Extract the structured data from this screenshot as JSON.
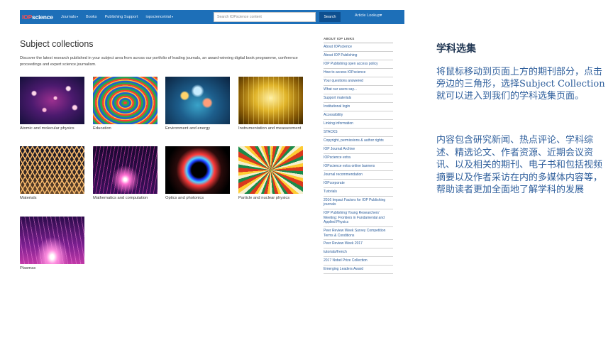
{
  "navbar": {
    "logo_prefix": "IOP",
    "logo_suffix": "science",
    "items": [
      {
        "label": "Journals",
        "has_caret": true
      },
      {
        "label": "Books",
        "has_caret": false
      },
      {
        "label": "Publishing Support",
        "has_caret": false
      },
      {
        "label": "iopsciencetrial",
        "has_caret": true
      }
    ],
    "search_placeholder": "Search IOPscience content",
    "search_button": "Search",
    "article_lookup": "Article Lookup",
    "caret_glyph": "▾"
  },
  "main": {
    "title": "Subject collections",
    "intro": "Discover the latest research published in your subject area from across our portfolio of leading journals, an award-winning digital book programme, conference proceedings and expert science journalism.",
    "collections": [
      {
        "label": "Atomic and molecular physics"
      },
      {
        "label": "Education"
      },
      {
        "label": "Environment and energy"
      },
      {
        "label": "Instrumentation and measurement"
      },
      {
        "label": "Materials"
      },
      {
        "label": "Mathematics and computation"
      },
      {
        "label": "Optics and photonics"
      },
      {
        "label": "Particle and nuclear physics"
      },
      {
        "label": "Plasmas"
      }
    ]
  },
  "sidebar": {
    "heading": "ABOUT IOP LINKS",
    "items": [
      "About IOPscience",
      "About IOP Publishing",
      "IOP Publishing open access policy",
      "How to access IOPscience",
      "Your questions answered",
      "What our users say...",
      "Support materials",
      "Institutional login",
      "Accessibility",
      "Linking information",
      "STACKS",
      "Copyright, permissions & author rights",
      "IOP Journal Archive",
      "IOPscience extra",
      "IOPscience extra online banners",
      "Journal recommendation",
      "IOPcorporate",
      "Tutorials",
      "2016 Impact Factors for IOP Publishing journals",
      "IOP Publishing Young Researchers' Meeting: Frontiers in Fundamental and Applied Physics",
      "Peer Review Week Survey Competition Terms & Conditions",
      "Peer Review Week 2017",
      "tutorials/french",
      "2017 Nobel Prize Collection",
      "Emerging Leaders Award"
    ]
  },
  "annotation": {
    "title": "学科选集",
    "paragraph1": "将鼠标移动到页面上方的期刊部分，点击旁边的三角形，选择Subject Collection就可以进入到我们的学科选集页面。",
    "paragraph2": "内容包含研究新闻、热点评论、学科综述、精选论文、作者资源、近期会议资讯、以及相关的期刊、电子书和包括视频摘要以及作者采访在内的多媒体内容等，帮助读者更加全面地了解学科的发展"
  }
}
